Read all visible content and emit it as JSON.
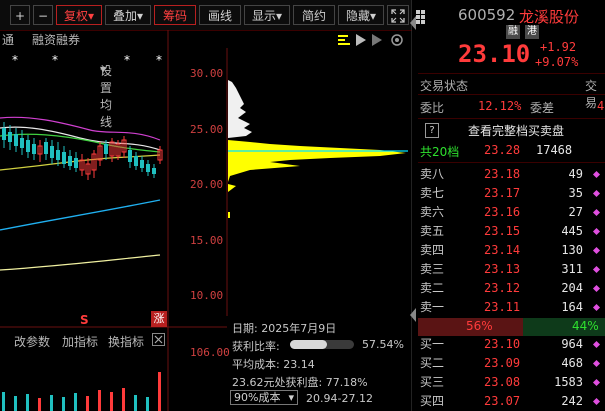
{
  "toolbar": {
    "plus": "+",
    "minus": "−",
    "fuquan": "复权",
    "fuquan_arrow": "▾",
    "diejia": "叠加",
    "diejia_arrow": "▾",
    "choujima": "筹码",
    "huaxian": "画线",
    "xianshi": "显示",
    "xianshi_arrow": "▾",
    "jianyue": "简约",
    "yincang": "隐藏",
    "yincang_arrow": "▾"
  },
  "subbar": {
    "item1": "通",
    "item2": "融资融券",
    "item3": "设置均线",
    "item3_arrow": "▾"
  },
  "yaxis": {
    "t30": "30.00",
    "t25": "25.00",
    "t20": "20.00",
    "t15": "15.00",
    "t10": "10.00",
    "vol": "106.00"
  },
  "bottom_tabs": {
    "t1": "改参数",
    "t2": "加指标",
    "t3": "换指标"
  },
  "chip_info": {
    "date": "日期: 2025年7月9日",
    "profit_label": "获利比率:",
    "profit_value": "57.54%",
    "profit_ratio": 0.5754,
    "avg_cost": "平均成本: 23.14",
    "profit_at": "23.62元处获利盘: 77.18%",
    "cost_select": "90%成本",
    "cost_range": "20.94-27.12"
  },
  "marks": {
    "s": "S",
    "zhang": "涨"
  },
  "stock": {
    "code": "600592",
    "name": "龙溪股份",
    "price": "23.10",
    "change": "+1.92",
    "change_pct": "+9.07%",
    "badge1": "融",
    "badge2": "港"
  },
  "status": {
    "label": "交易状态",
    "label2": "交易"
  },
  "weibi": {
    "label": "委比",
    "value": "12.12%",
    "label2": "委差",
    "value2": "4"
  },
  "full_book": "查看完整档买卖盘",
  "gong20": {
    "label": "共20档",
    "price": "23.28",
    "vol": "17468"
  },
  "asks": [
    {
      "label": "卖八",
      "price": "23.18",
      "vol": "49"
    },
    {
      "label": "卖七",
      "price": "23.17",
      "vol": "35"
    },
    {
      "label": "卖六",
      "price": "23.16",
      "vol": "27"
    },
    {
      "label": "卖五",
      "price": "23.15",
      "vol": "445"
    },
    {
      "label": "卖四",
      "price": "23.14",
      "vol": "130"
    },
    {
      "label": "卖三",
      "price": "23.13",
      "vol": "311"
    },
    {
      "label": "卖二",
      "price": "23.12",
      "vol": "204"
    },
    {
      "label": "卖一",
      "price": "23.11",
      "vol": "164"
    }
  ],
  "ratio": {
    "left": "56%",
    "right": "44%",
    "left_frac": 0.56
  },
  "bids": [
    {
      "label": "买一",
      "price": "23.10",
      "vol": "964"
    },
    {
      "label": "买二",
      "price": "23.09",
      "vol": "468"
    },
    {
      "label": "买三",
      "price": "23.08",
      "vol": "1583"
    },
    {
      "label": "买四",
      "price": "23.07",
      "vol": "242"
    }
  ],
  "colors": {
    "up": "#ff3b3b",
    "down": "#2ee02e",
    "chip_yellow": "#ffff00",
    "accent_cyan": "#00e5ff"
  }
}
